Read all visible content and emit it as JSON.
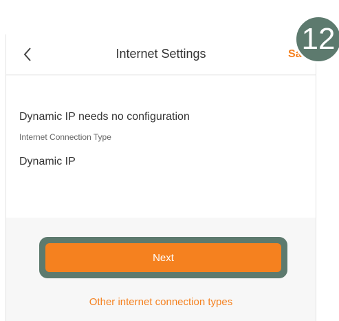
{
  "header": {
    "title": "Internet Settings",
    "save_label": "Save",
    "back_icon": "chevron-left-icon"
  },
  "content": {
    "message": "Dynamic IP needs no configuration",
    "connection_type_label": "Internet Connection Type",
    "connection_type_value": "Dynamic IP"
  },
  "actions": {
    "next_label": "Next",
    "other_types_label": "Other internet connection types"
  },
  "step_badge": "12",
  "colors": {
    "accent": "#f5811f",
    "badge": "#5d7a6e"
  }
}
